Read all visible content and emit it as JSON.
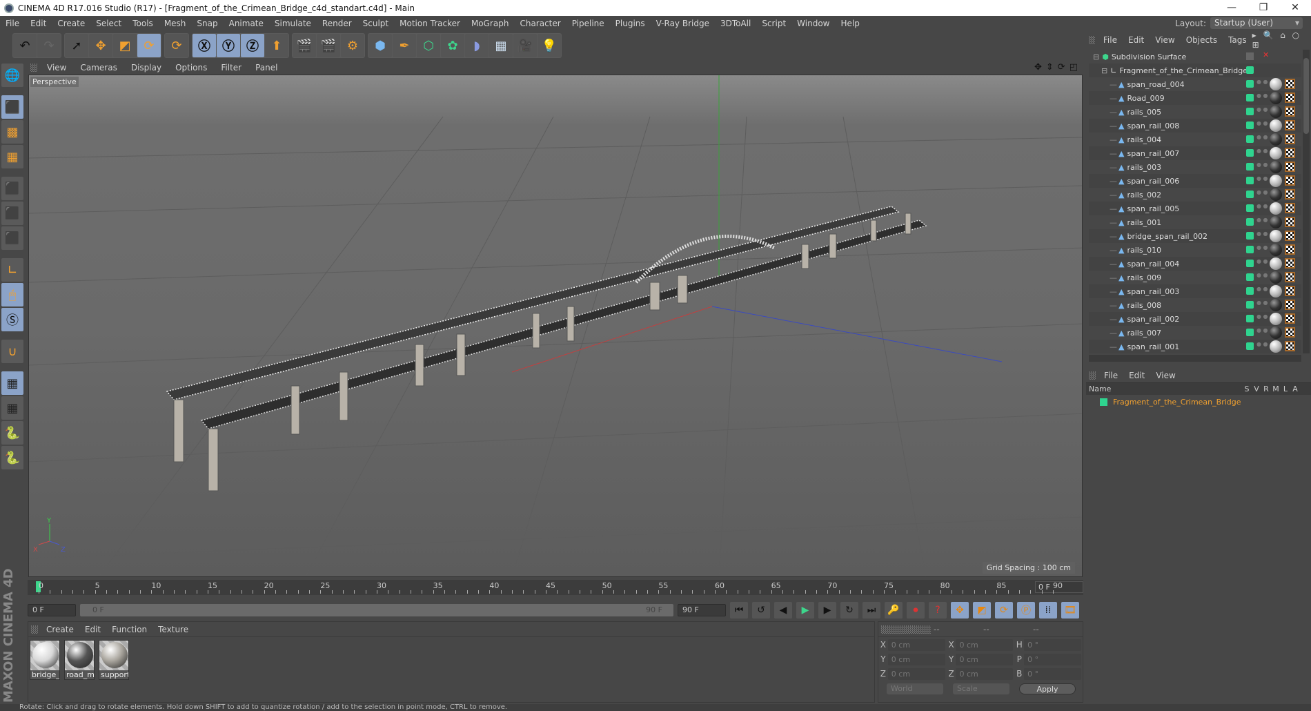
{
  "window": {
    "title": "CINEMA 4D R17.016 Studio (R17) - [Fragment_of_the_Crimean_Bridge_c4d_standart.c4d] - Main",
    "controls": [
      "—",
      "❐",
      "✕"
    ]
  },
  "menu": [
    "File",
    "Edit",
    "Create",
    "Select",
    "Tools",
    "Mesh",
    "Snap",
    "Animate",
    "Simulate",
    "Render",
    "Sculpt",
    "Motion Tracker",
    "MoGraph",
    "Character",
    "Pipeline",
    "Plugins",
    "V-Ray Bridge",
    "3DToAll",
    "Script",
    "Window",
    "Help"
  ],
  "layout": {
    "label": "Layout:",
    "value": "Startup (User)"
  },
  "viewport": {
    "menu": [
      "View",
      "Cameras",
      "Display",
      "Options",
      "Filter",
      "Panel"
    ],
    "camera_label": "Perspective",
    "grid_spacing": "Grid Spacing : 100 cm",
    "axes": {
      "x": "X",
      "y": "Y",
      "z": "Z"
    }
  },
  "timeline": {
    "ticks": [
      "0",
      "5",
      "10",
      "15",
      "20",
      "25",
      "30",
      "35",
      "40",
      "45",
      "50",
      "55",
      "60",
      "65",
      "70",
      "75",
      "80",
      "85",
      "90"
    ],
    "current_frame": "0 F",
    "start_field": "0 F",
    "range_start": "0 F",
    "range_end": "90 F",
    "end_field": "90 F"
  },
  "materials": {
    "menu": [
      "Create",
      "Edit",
      "Function",
      "Texture"
    ],
    "items": [
      {
        "name": "bridge_r",
        "color": "#d8d8d8"
      },
      {
        "name": "road_ma",
        "color": "#555555"
      },
      {
        "name": "support",
        "color": "#a9a59d"
      }
    ]
  },
  "brand": "MAXON CINEMA 4D",
  "coordinates": {
    "headers": [
      "--",
      "--",
      "--"
    ],
    "rows": [
      {
        "a1": "X",
        "v1": "0 cm",
        "a2": "X",
        "v2": "0 cm",
        "a3": "H",
        "v3": "0 °"
      },
      {
        "a1": "Y",
        "v1": "0 cm",
        "a2": "Y",
        "v2": "0 cm",
        "a3": "P",
        "v3": "0 °"
      },
      {
        "a1": "Z",
        "v1": "0 cm",
        "a2": "Z",
        "v2": "0 cm",
        "a3": "B",
        "v3": "0 °"
      }
    ],
    "mode": "World",
    "transform": "Scale",
    "apply": "Apply"
  },
  "objects": {
    "menu": [
      "File",
      "Edit",
      "View",
      "Objects",
      "Tags"
    ],
    "root": "Subdivision Surface",
    "group": "Fragment_of_the_Crimean_Bridge",
    "items": [
      {
        "name": "span_road_004",
        "mat": "light"
      },
      {
        "name": "Road_009",
        "mat": "dark"
      },
      {
        "name": "rails_005",
        "mat": "dark"
      },
      {
        "name": "span_rail_008",
        "mat": "light"
      },
      {
        "name": "rails_004",
        "mat": "dark"
      },
      {
        "name": "span_rail_007",
        "mat": "light"
      },
      {
        "name": "rails_003",
        "mat": "dark"
      },
      {
        "name": "span_rail_006",
        "mat": "light"
      },
      {
        "name": "rails_002",
        "mat": "dark"
      },
      {
        "name": "span_rail_005",
        "mat": "light"
      },
      {
        "name": "rails_001",
        "mat": "dark"
      },
      {
        "name": "bridge_span_rail_002",
        "mat": "light"
      },
      {
        "name": "rails_010",
        "mat": "dark"
      },
      {
        "name": "span_rail_004",
        "mat": "light"
      },
      {
        "name": "rails_009",
        "mat": "dark"
      },
      {
        "name": "span_rail_003",
        "mat": "light"
      },
      {
        "name": "rails_008",
        "mat": "dark"
      },
      {
        "name": "span_rail_002",
        "mat": "light"
      },
      {
        "name": "rails_007",
        "mat": "dark"
      },
      {
        "name": "span_rail_001",
        "mat": "light"
      }
    ]
  },
  "layers": {
    "menu": [
      "File",
      "Edit",
      "View"
    ],
    "columns": [
      "Name",
      "S",
      "V",
      "R",
      "M",
      "L",
      "A"
    ],
    "row": "Fragment_of_the_Crimean_Bridge"
  },
  "status": "Rotate: Click and drag to rotate elements. Hold down SHIFT to add to quantize rotation / add to the selection in point mode, CTRL to remove."
}
